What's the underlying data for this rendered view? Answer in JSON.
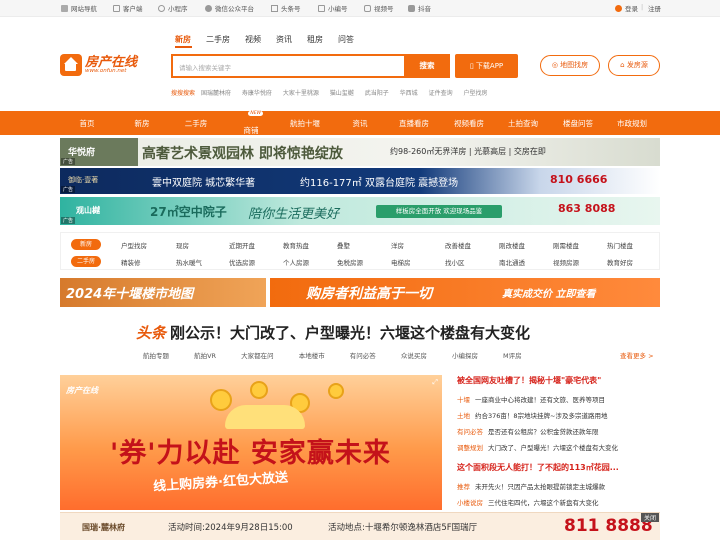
{
  "topbar": {
    "items": [
      "网站导航",
      "客户端",
      "小程序",
      "微信公众平台",
      "头条号",
      "小编号",
      "视频号",
      "抖音"
    ],
    "login": "登录",
    "register": "注册",
    "divider": "|"
  },
  "logo": {
    "cn": "房产在线",
    "en": "www.onfun.net"
  },
  "search_tabs": [
    "新房",
    "二手房",
    "视频",
    "资讯",
    "租房",
    "问答"
  ],
  "search": {
    "placeholder": "请输入搜索关键字",
    "button": "搜索"
  },
  "download_app": "下载APP",
  "hot_search": {
    "label": "搜搜搜索",
    "items": [
      "国瑞麓林府",
      "寿康华悦府",
      "大家十里桃源",
      "猫山玺樾",
      "武当阳子",
      "华西城",
      "证件查询",
      "户型找房"
    ]
  },
  "map_search": "地图找房",
  "post_listing": "发房源",
  "nav": [
    "首页",
    "新房",
    "二手房",
    "商铺",
    "航拍十堰",
    "资讯",
    "直播看房",
    "视频看房",
    "土拍查询",
    "楼盘问答",
    "市政规划"
  ],
  "nav_badge": "NEW",
  "ads": {
    "ad1_brand": "华悦府",
    "ad1_text": "高奢艺术景观园林 即将惊艳绽放",
    "ad1_detail": "约98-260㎡无界洋房 | 光慕高层 | 交房在即",
    "ad2_brand": "御临·壹著",
    "ad2_text": "雲中双庭院 城芯繁华著",
    "ad2_area": "约116-177㎡ 双露台庭院 震撼登场",
    "ad2_phone": "810 6666",
    "ad3_brand": "观山樾",
    "ad3_text": "27㎡空中院子",
    "ad3_slogan": "陪你生活更美好",
    "ad3_cta": "样板房全面开放 欢迎现场品鉴",
    "ad3_phone": "863 8088",
    "ad_tag": "广告"
  },
  "categories": {
    "new_label": "新房",
    "new_items": [
      "户型找房",
      "现房",
      "近期开盘",
      "教育热盘",
      "叠墅",
      "洋房",
      "改善楼盘",
      "刚改楼盘",
      "刚需楼盘",
      "热门楼盘"
    ],
    "second_label": "二手房",
    "second_items": [
      "精装修",
      "热水暖气",
      "优选房源",
      "个人房源",
      "免税房源",
      "电梯房",
      "找小区",
      "南北通透",
      "视频房源",
      "教育好房"
    ]
  },
  "banners": {
    "left": "2024年十堰楼市地图",
    "right_slogan": "购房者利益高于一切",
    "right_cta": "真实成交价 立即查看"
  },
  "headline": {
    "tag": "头条",
    "text": "刚公示！大门改了、户型曝光！六堰这个楼盘有大变化"
  },
  "sublinks": [
    "航拍专题",
    "航拍VR",
    "大家都在问",
    "本地楼市",
    "有问必答",
    "众说买房",
    "小编探房",
    "M评房"
  ],
  "more": "查看更多 >",
  "hero": {
    "logo": "房产在线",
    "title": "'券'力以赴 安家赢未来",
    "subtitle": "线上购房券·红包大放送"
  },
  "news": [
    {
      "title": true,
      "text": "被全国网友吐槽了！揭秘十堰\"豪宅代表\""
    },
    {
      "k": "十堰",
      "t": "一座商业中心将改建！还有文旅、医养等项目"
    },
    {
      "k": "土地",
      "t": "约合376亩！8宗地块挂牌~涉及多宗道路用地"
    },
    {
      "k": "有问必答",
      "t": "是否还有公租房？公积金贷款还款年限"
    },
    {
      "k": "调整规划",
      "t": "大门改了、户型曝光！六堰这个楼盘有大变化"
    },
    {
      "title": true,
      "text": "这个面积段无人能打！了不起的113㎡花园..."
    },
    {
      "k": "推荐",
      "t": "未开先火！只因产品太抢眼提前锁定主城爆款"
    },
    {
      "k": "小楼说房",
      "t": "三代住宅四代，六堰这个新盘有大变化"
    }
  ],
  "bottom_ad": {
    "brand": "国瑞·麓林府",
    "time": "活动时间:2024年9月28日15:00",
    "place": "活动地点:十堰希尔顿逸林酒店5F国瑞厅",
    "phone": "811 8888",
    "close": "关闭"
  },
  "colors": {
    "accent": "#f26b0e",
    "headline": "#d6231b"
  }
}
